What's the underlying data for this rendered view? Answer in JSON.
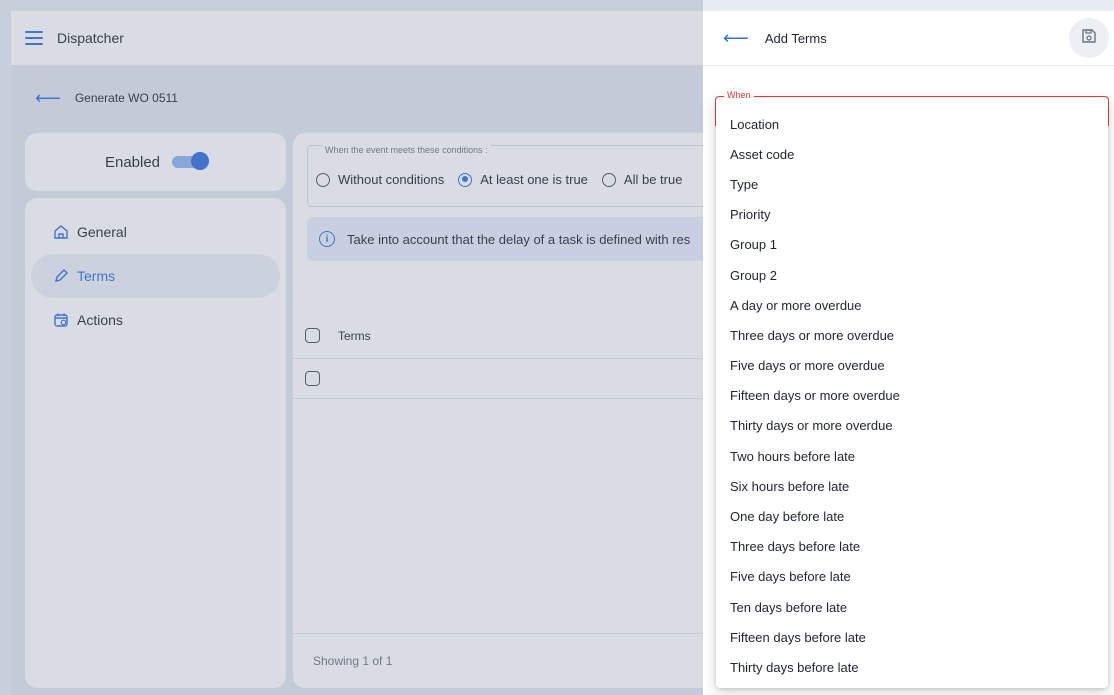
{
  "topbar": {
    "title": "Dispatcher"
  },
  "subbar": {
    "title": "Generate WO 0511"
  },
  "enabled": {
    "label": "Enabled",
    "on": true
  },
  "nav": {
    "items": [
      {
        "label": "General",
        "icon": "home-icon"
      },
      {
        "label": "Terms",
        "icon": "pencil-icon",
        "active": true
      },
      {
        "label": "Actions",
        "icon": "calendar-icon"
      }
    ]
  },
  "conditions": {
    "legend": "When the event meets these conditions :",
    "options": [
      {
        "label": "Without conditions",
        "checked": false
      },
      {
        "label": "At least one is true",
        "checked": true
      },
      {
        "label": "All be true",
        "checked": false
      }
    ]
  },
  "info": {
    "text": "Take into account that the delay of a task is defined with res"
  },
  "table": {
    "header": "Terms",
    "footer": "Showing 1 of 1"
  },
  "panel": {
    "title": "Add Terms",
    "when_label": "When"
  },
  "dropdown": {
    "options": [
      "Location",
      "Asset code",
      "Type",
      "Priority",
      "Group 1",
      "Group 2",
      "A day or more overdue",
      "Three days or more overdue",
      "Five days or more overdue",
      "Fifteen days or more overdue",
      "Thirty days or more overdue",
      "Two hours before late",
      "Six hours before late",
      "One day before late",
      "Three days before late",
      "Five days before late",
      "Ten days before late",
      "Fifteen days before late",
      "Thirty days before late"
    ]
  },
  "colors": {
    "accent": "#2f6fe0",
    "error": "#e0424a"
  }
}
